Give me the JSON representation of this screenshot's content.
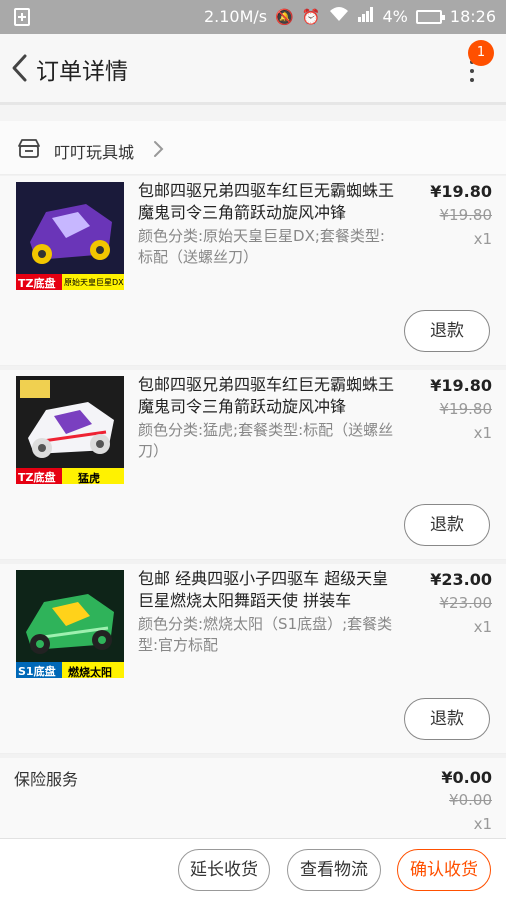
{
  "status_bar": {
    "speed": "2.10M/s",
    "battery_percent": "4%",
    "time": "18:26",
    "icons": [
      "notification-icon",
      "mute-icon",
      "alarm-icon",
      "wifi-icon",
      "signal-icon",
      "battery-icon"
    ]
  },
  "header": {
    "title": "订单详情",
    "badge_count": "1"
  },
  "shop": {
    "name": "叮叮玩具城"
  },
  "items": [
    {
      "title": "包邮四驱兄弟四驱车红巨无霸蜘蛛王魔鬼司令三角箭跃动旋风冲锋",
      "spec": "颜色分类:原始天皇巨星DX;套餐类型:标配（送螺丝刀）",
      "price": "¥19.80",
      "original_price": "¥19.80",
      "quantity": "x1",
      "refund_label": "退款",
      "thumb_badge": "TZ底盘",
      "thumb_caption": "原始天皇巨星DX",
      "car_color": "#5a2ea0"
    },
    {
      "title": "包邮四驱兄弟四驱车红巨无霸蜘蛛王魔鬼司令三角箭跃动旋风冲锋",
      "spec": "颜色分类:猛虎;套餐类型:标配（送螺丝刀）",
      "price": "¥19.80",
      "original_price": "¥19.80",
      "quantity": "x1",
      "refund_label": "退款",
      "thumb_badge": "TZ底盘",
      "thumb_caption": "猛虎",
      "car_color": "#e8e8f0"
    },
    {
      "title": "包邮 经典四驱小子四驱车 超级天皇巨星燃烧太阳舞蹈天使 拼装车",
      "spec": "颜色分类:燃烧太阳（S1底盘）;套餐类型:官方标配",
      "price": "¥23.00",
      "original_price": "¥23.00",
      "quantity": "x1",
      "refund_label": "退款",
      "thumb_badge": "S1底盘",
      "thumb_caption": "燃烧太阳",
      "car_color": "#2fb35a"
    }
  ],
  "insurance": {
    "label": "保险服务",
    "price": "¥0.00",
    "original_price": "¥0.00",
    "quantity": "x1"
  },
  "bottom_bar": {
    "extend_label": "延长收货",
    "logistics_label": "查看物流",
    "confirm_label": "确认收货"
  },
  "colors": {
    "accent": "#ff5000",
    "status_bar": "#a9a9a9"
  }
}
